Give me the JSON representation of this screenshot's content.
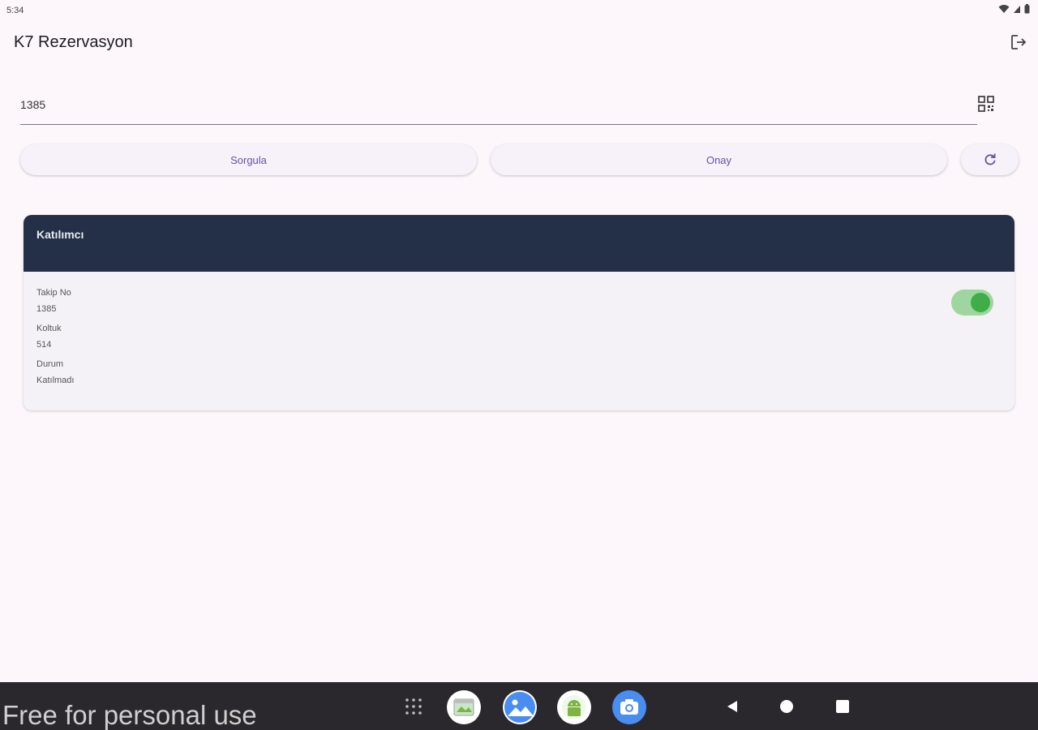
{
  "status_bar": {
    "time": "5:34",
    "icons": [
      "wifi-icon",
      "signal-icon",
      "battery-icon"
    ]
  },
  "app_bar": {
    "title": "K7 Rezervasyon",
    "action_icon": "logout-icon"
  },
  "search": {
    "value": "1385",
    "scan_icon": "qr-code-icon"
  },
  "actions": {
    "query_label": "Sorgula",
    "confirm_label": "Onay",
    "refresh_icon": "refresh-icon"
  },
  "card": {
    "header": "Katılımcı",
    "fields": [
      {
        "label": "Takip No",
        "value": "1385"
      },
      {
        "label": "Koltuk",
        "value": "514"
      },
      {
        "label": "Durum",
        "value": "Katılmadı"
      }
    ],
    "toggle_on": true
  },
  "nav": {
    "watermark": "Free for personal use",
    "apps": [
      "app-drawer-icon",
      "gallery-widget-icon",
      "photos-icon",
      "android-app-icon",
      "camera-icon"
    ],
    "buttons": [
      "back-icon",
      "home-icon",
      "recents-icon"
    ]
  },
  "colors": {
    "accent": "#6750a4",
    "card_header": "#233047",
    "toggle_track": "#9fd6a0",
    "toggle_knob": "#3fae49",
    "background": "#fdf7fc"
  }
}
